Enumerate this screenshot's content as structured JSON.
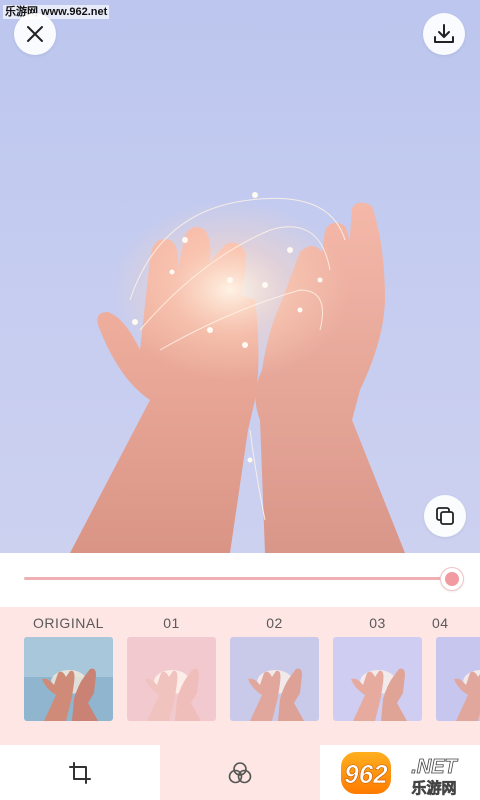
{
  "watermark_top": "乐游网 www.962.net",
  "preview": {
    "close_icon": "close-icon",
    "download_icon": "download-icon",
    "compare_icon": "compare-icon"
  },
  "slider": {
    "value_fraction": 1.0
  },
  "filters": [
    {
      "label": "ORIGINAL",
      "tint": "#9fc1d6"
    },
    {
      "label": "01",
      "tint": "#f2c9cf"
    },
    {
      "label": "02",
      "tint": "#c9c9ea"
    },
    {
      "label": "03",
      "tint": "#cfcdf1"
    },
    {
      "label": "04",
      "tint": "#c6c6ef"
    }
  ],
  "toolbar": {
    "crop_icon": "crop-icon",
    "filter_icon": "filter-circles-icon",
    "selected": "filter"
  },
  "logo": {
    "text_962": "962",
    "text_net": ".NET",
    "text_cn": "乐游网"
  },
  "colors": {
    "accent": "#f19aa2",
    "strip_bg": "#fde6e4",
    "sky": "#c3cbef"
  }
}
